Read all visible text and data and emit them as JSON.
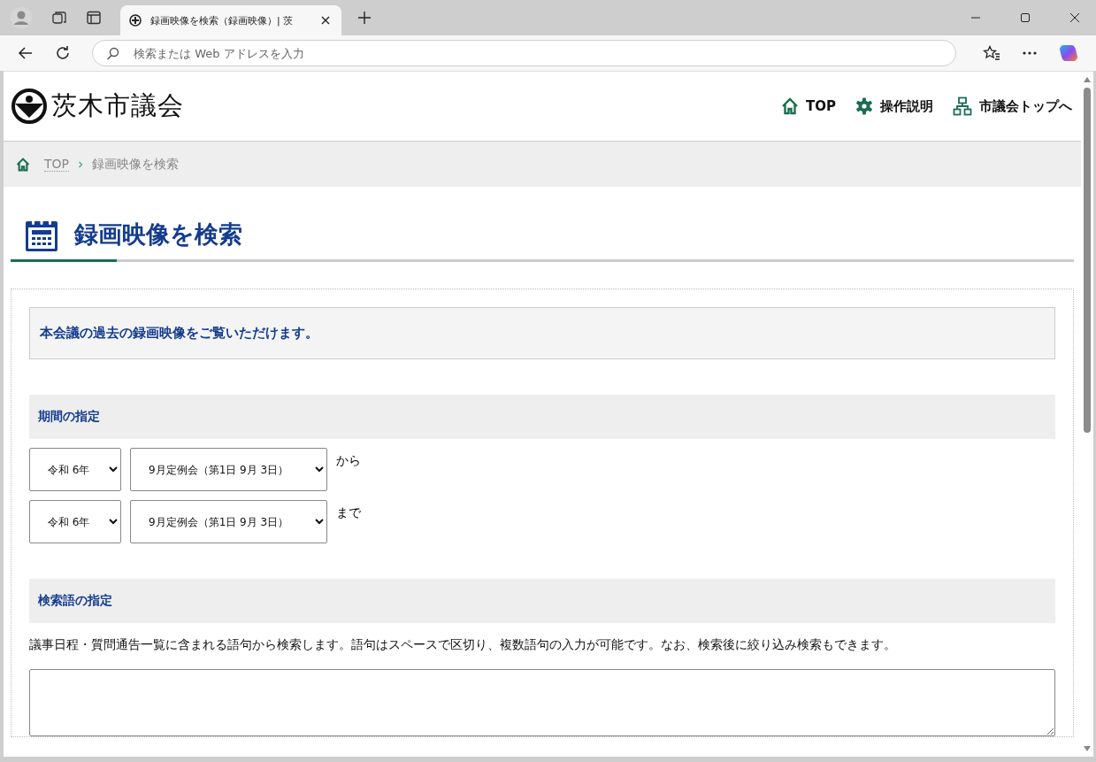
{
  "browser": {
    "tab_title": "録画映像を検索（録画映像）| 茨",
    "address_placeholder": "検索または Web アドレスを入力"
  },
  "header": {
    "logo_text": "茨木市議会",
    "nav": [
      {
        "label": "TOP",
        "kind": "home"
      },
      {
        "label": "操作説明",
        "kind": "gear"
      },
      {
        "label": "市議会トップへ",
        "kind": "sitemap"
      }
    ]
  },
  "breadcrumb": {
    "link": "TOP",
    "current": "録画映像を検索"
  },
  "page_title": "録画映像を検索",
  "intro": "本会議の過去の録画映像をご覧いただけます。",
  "period": {
    "heading": "期間の指定",
    "rows": [
      {
        "era": "令和 6年",
        "meeting": "9月定例会（第1日 9月 3日）",
        "suffix": "から"
      },
      {
        "era": "令和 6年",
        "meeting": "9月定例会（第1日 9月 3日）",
        "suffix": "まで"
      }
    ]
  },
  "keyword": {
    "heading": "検索語の指定",
    "description": "議事日程・質問通告一覧に含まれる語句から検索します。語句はスペースで区切り、複数語句の入力が可能です。なお、検索後に絞り込み検索もできます。"
  }
}
